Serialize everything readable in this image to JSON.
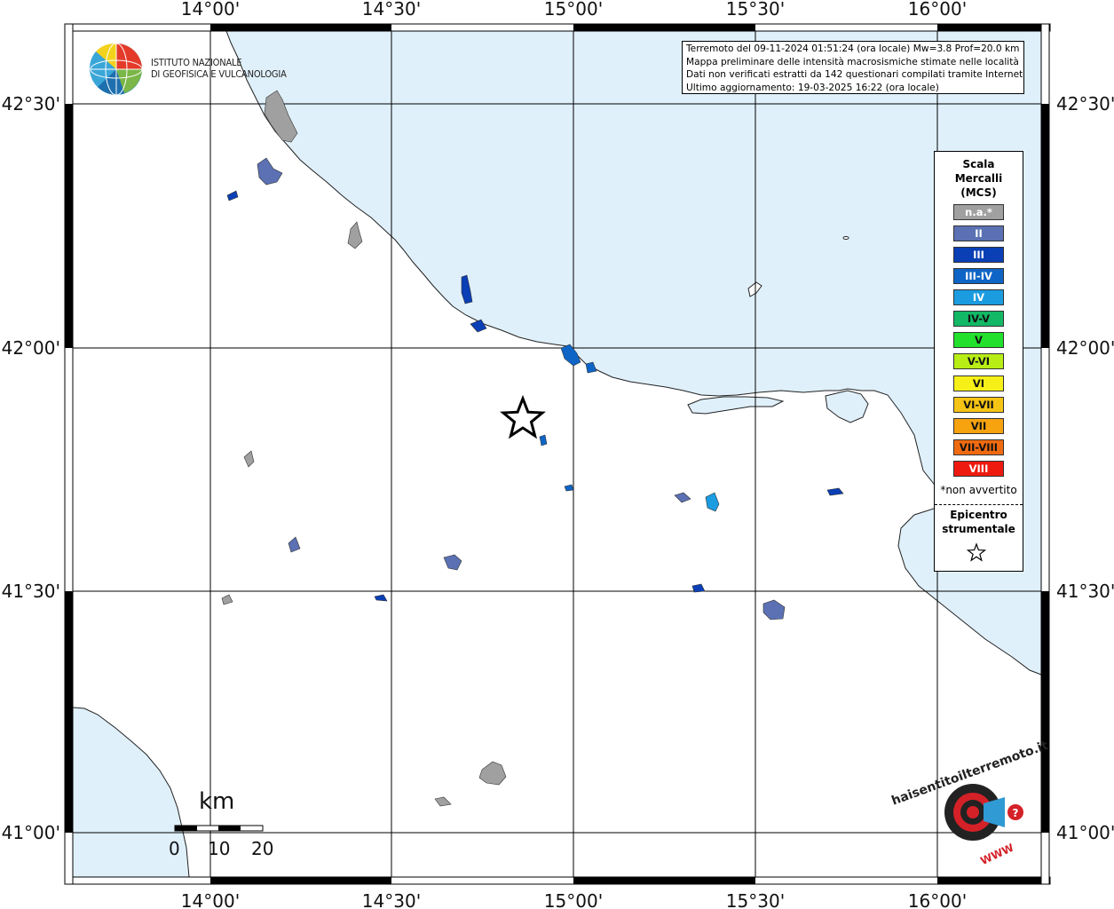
{
  "map": {
    "lon_labels": [
      "14°00'",
      "14°30'",
      "15°00'",
      "15°30'",
      "16°00'"
    ],
    "lat_labels": [
      "42°30'",
      "42°00'",
      "41°30'",
      "41°00'"
    ],
    "colors": {
      "sea": "#dff0fb",
      "land": "#ffffff",
      "grid": "#000000"
    }
  },
  "logo": {
    "line1": "ISTITUTO NAZIONALE",
    "line2": "DI GEOFISICA E VULCANOLOGIA"
  },
  "info": {
    "line1": "Terremoto del 09-11-2024 01:51:24 (ora locale) Mw=3.8 Prof=20.0 km",
    "line2": "Mappa preliminare delle intensità macrosismiche stimate nelle località",
    "line3": "Dati non verificati estratti da 142 questionari compilati tramite Internet.",
    "line4": "Ultimo aggiornamento: 19-03-2025 16:22 (ora locale)"
  },
  "legend": {
    "title_line1": "Scala",
    "title_line2": "Mercalli",
    "title_line3": "(MCS)",
    "items": [
      {
        "label": "n.a.*",
        "color": "#a0a0a0"
      },
      {
        "label": "II",
        "color": "#5b71b3"
      },
      {
        "label": "III",
        "color": "#0a3fb5"
      },
      {
        "label": "III-IV",
        "color": "#0e65c6"
      },
      {
        "label": "IV",
        "color": "#1b9ce0"
      },
      {
        "label": "IV-V",
        "color": "#12b865"
      },
      {
        "label": "V",
        "color": "#22e02c"
      },
      {
        "label": "V-VI",
        "color": "#b8ed16"
      },
      {
        "label": "VI",
        "color": "#f6f018"
      },
      {
        "label": "VI-VII",
        "color": "#f5c414"
      },
      {
        "label": "VII",
        "color": "#f7a20f"
      },
      {
        "label": "VII-VIII",
        "color": "#f06a10"
      },
      {
        "label": "VIII",
        "color": "#ee1a0f"
      }
    ],
    "na_note": "*non avvertito",
    "epicenter_line1": "Epicentro",
    "epicenter_line2": "strumentale"
  },
  "scale_bar": {
    "unit": "km",
    "ticks": [
      "0",
      "10",
      "20"
    ]
  },
  "watermark": {
    "text": "haisentitoilterremoto.it",
    "url": "WWW"
  }
}
